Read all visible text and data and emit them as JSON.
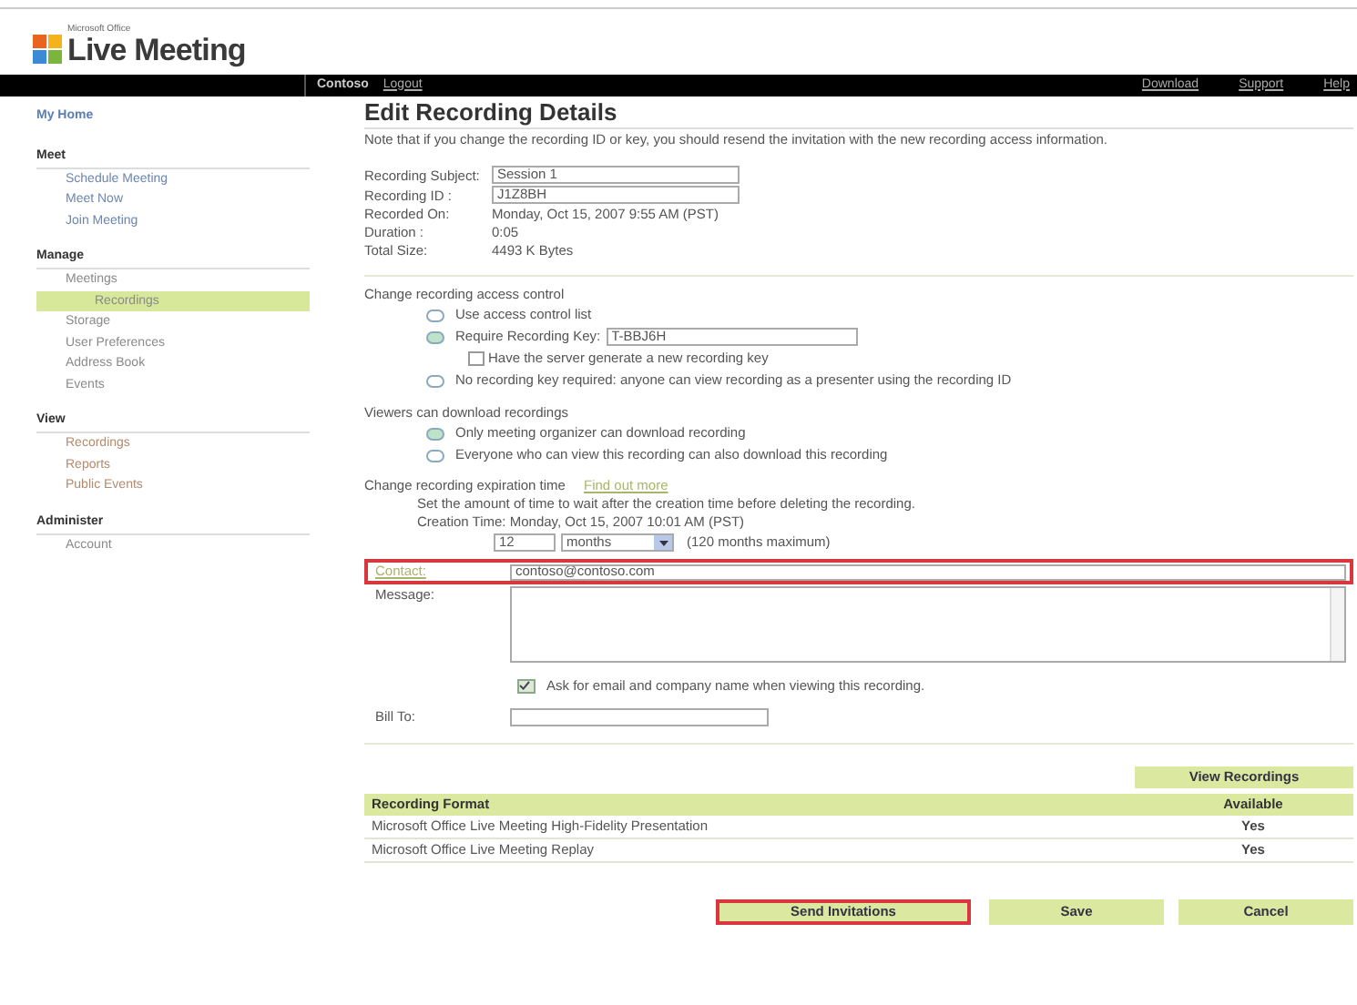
{
  "logo": {
    "small": "Microsoft Office",
    "name": "Live Meeting"
  },
  "topbar": {
    "company": "Contoso",
    "logout": "Logout",
    "links": [
      "Download",
      "Support",
      "Help"
    ]
  },
  "sidebar": {
    "home": "My Home",
    "sections": [
      {
        "title": "Meet",
        "color": "#6b86b0",
        "items": [
          {
            "label": "Schedule Meeting",
            "selected": false
          },
          {
            "label": "Meet Now",
            "selected": false
          },
          {
            "label": "Join Meeting",
            "selected": false
          }
        ]
      },
      {
        "title": "Manage",
        "color": "#8a8a8a",
        "items": [
          {
            "label": "Meetings",
            "selected": false
          },
          {
            "label": "Recordings",
            "selected": true
          },
          {
            "label": "Storage",
            "selected": false
          },
          {
            "label": "User Preferences",
            "selected": false
          },
          {
            "label": "Address Book",
            "selected": false
          },
          {
            "label": "Events",
            "selected": false
          }
        ]
      },
      {
        "title": "View",
        "color": "#b58a6a",
        "items": [
          {
            "label": "Recordings",
            "selected": false
          },
          {
            "label": "Reports",
            "selected": false
          },
          {
            "label": "Public Events",
            "selected": false
          }
        ]
      },
      {
        "title": "Administer",
        "color": "#8a8a8a",
        "items": [
          {
            "label": "Account",
            "selected": false
          }
        ]
      }
    ]
  },
  "page": {
    "title": "Edit Recording Details",
    "note": "Note that if you change the recording ID or key, you should resend the invitation with the new recording access information."
  },
  "details": [
    {
      "kind": "field",
      "label": "Recording Subject:",
      "value": "Session 1"
    },
    {
      "kind": "field",
      "label": "Recording ID :",
      "value": "J1Z8BH"
    },
    {
      "kind": "text",
      "label": "Recorded On:",
      "value": "Monday, Oct 15, 2007 9:55 AM (PST)"
    },
    {
      "kind": "text",
      "label": "Duration :",
      "value": "0:05"
    },
    {
      "kind": "text",
      "label": "Total Size:",
      "value": "4493 K Bytes"
    }
  ],
  "access": {
    "heading": "Change recording access control",
    "options": [
      {
        "label": "Use access control list",
        "selected": false
      },
      {
        "label": "Require Recording Key:",
        "selected": true,
        "key": "T-BBJ6H",
        "generate": {
          "label": "Have the server generate a new recording key",
          "checked": false
        }
      },
      {
        "label": "No recording key required: anyone can view recording as a presenter using the recording ID",
        "selected": false
      }
    ]
  },
  "download": {
    "heading": "Viewers can download recordings",
    "options": [
      {
        "label": "Only meeting organizer can download recording",
        "selected": true
      },
      {
        "label": "Everyone who can view this recording can also download this recording",
        "selected": false
      }
    ]
  },
  "expiration": {
    "heading": "Change recording expiration time",
    "link": "Find out more",
    "description": "Set the amount of time to wait after the creation time before deleting the recording.",
    "creation": "Creation Time: Monday, Oct 15, 2007 10:01 AM (PST)",
    "amount": "12",
    "unit": "months",
    "limit": "(120 months maximum)"
  },
  "contact": {
    "label": "Contact:",
    "value": "contoso@contoso.com",
    "highlighted": true
  },
  "message": {
    "label": "Message:"
  },
  "ask": {
    "label": "Ask for email and company name when viewing this recording.",
    "checked": true
  },
  "bill_to": {
    "label": "Bill To:"
  },
  "view_recordings": "View Recordings",
  "formats": {
    "columns": [
      "Recording Format",
      "Available"
    ],
    "rows": [
      [
        "Microsoft Office Live Meeting High-Fidelity Presentation",
        "Yes"
      ],
      [
        "Microsoft Office Live Meeting Replay",
        "Yes"
      ]
    ]
  },
  "buttons": [
    {
      "label": "Send Invitations",
      "highlighted": true
    },
    {
      "label": "Save",
      "highlighted": false
    },
    {
      "label": "Cancel",
      "highlighted": false
    }
  ]
}
